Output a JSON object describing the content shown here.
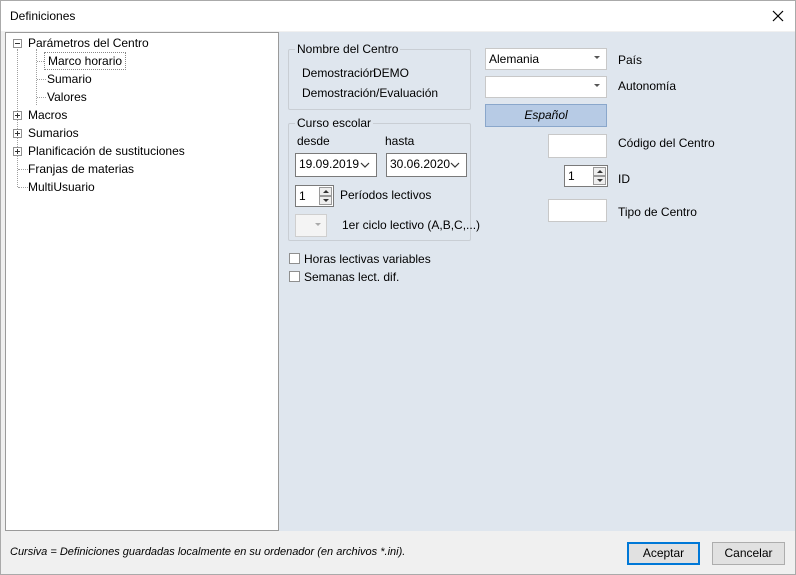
{
  "window": {
    "title": "Definiciones"
  },
  "tree": {
    "items": [
      {
        "label": "Parámetros del Centro",
        "expander": "minus"
      },
      {
        "label": "Marco horario",
        "selected": true
      },
      {
        "label": "Sumario"
      },
      {
        "label": "Valores"
      },
      {
        "label": "Macros",
        "expander": "plus"
      },
      {
        "label": "Sumarios",
        "expander": "plus"
      },
      {
        "label": "Planificación de sustituciones",
        "expander": "plus"
      },
      {
        "label": "Franjas de materias"
      },
      {
        "label": "MultiUsuario"
      }
    ]
  },
  "centro": {
    "group_title": "Nombre del Centro",
    "name_short": "Demostración",
    "name_code": "DEMO",
    "name_long": "Demostración/Evaluación"
  },
  "curso": {
    "group_title": "Curso escolar",
    "desde_label": "desde",
    "hasta_label": "hasta",
    "desde_value": "19.09.2019",
    "hasta_value": "30.06.2020",
    "periodos_value": "1",
    "periodos_label": "Períodos lectivos",
    "ciclo_label": "1er ciclo lectivo (A,B,C,...)"
  },
  "checks": {
    "horas_label": "Horas lectivas variables",
    "semanas_label": "Semanas lect. dif."
  },
  "right": {
    "pais_value": "Alemania",
    "pais_label": "País",
    "autonomia_value": "",
    "autonomia_label": "Autonomía",
    "language_button": "Español",
    "codigo_label": "Código del Centro",
    "id_value": "1",
    "id_label": "ID",
    "tipo_label": "Tipo de Centro"
  },
  "footer": {
    "note": "Cursiva = Definiciones guardadas localmente en su ordenador (en archivos *.ini).",
    "accept": "Aceptar",
    "cancel": "Cancelar"
  }
}
